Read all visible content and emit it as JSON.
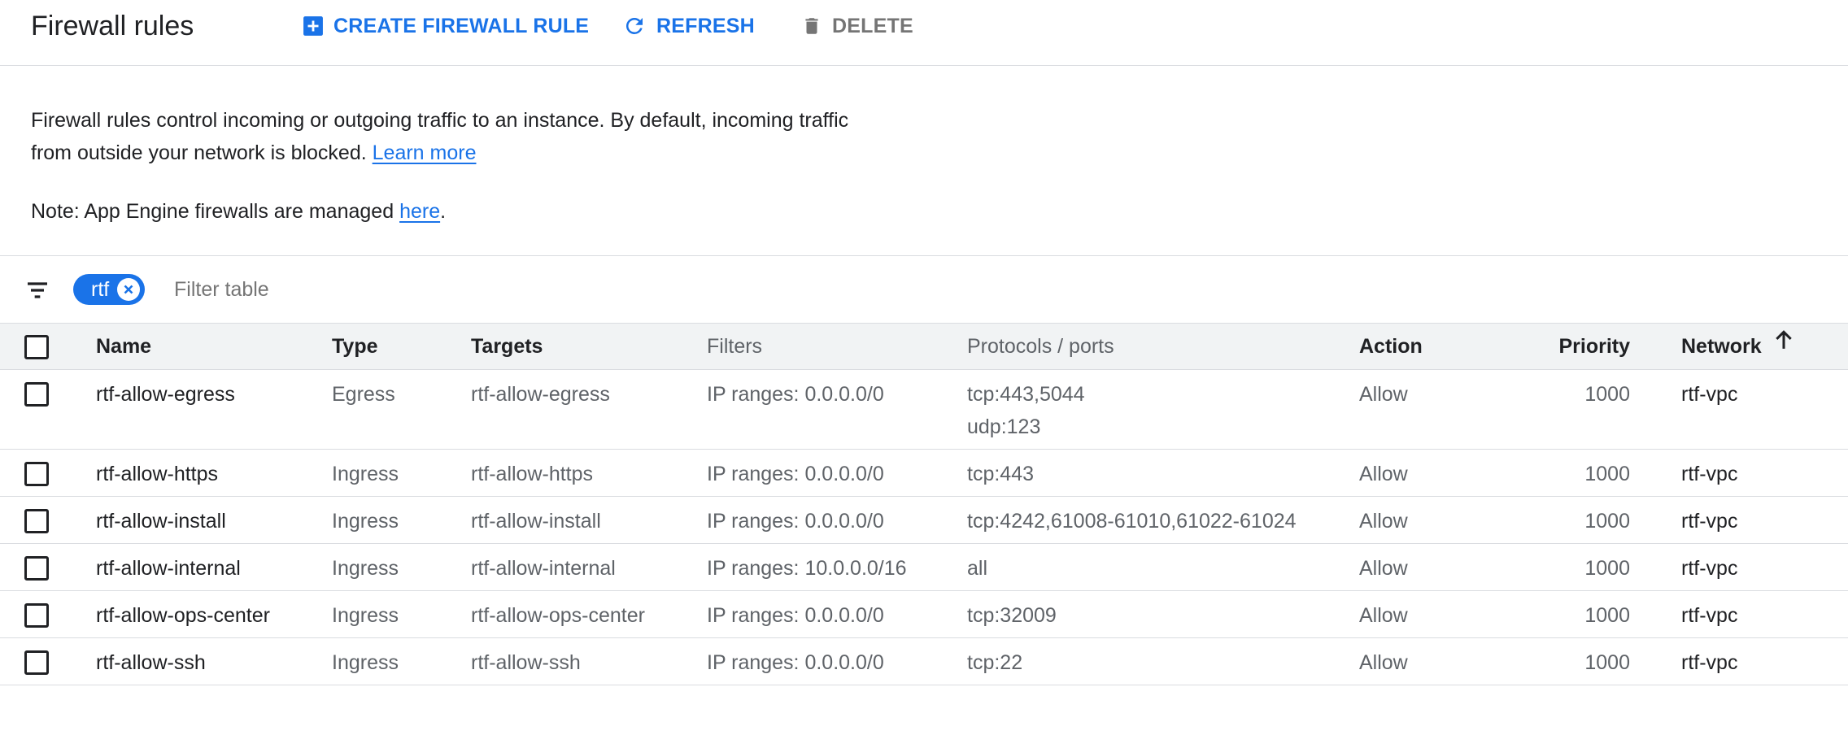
{
  "header": {
    "title": "Firewall rules",
    "create_label": "CREATE FIREWALL RULE",
    "refresh_label": "REFRESH",
    "delete_label": "DELETE"
  },
  "description": {
    "text": "Firewall rules control incoming or outgoing traffic to an instance. By default, incoming traffic from outside your network is blocked.",
    "learn_more": "Learn more",
    "note_prefix": "Note: App Engine firewalls are managed",
    "note_link": "here",
    "note_suffix": "."
  },
  "filter": {
    "chip_label": "rtf",
    "placeholder": "Filter table"
  },
  "table": {
    "columns": {
      "name": "Name",
      "type": "Type",
      "targets": "Targets",
      "filters": "Filters",
      "protocols": "Protocols / ports",
      "action": "Action",
      "priority": "Priority",
      "network": "Network"
    },
    "sort_column": "Network",
    "sort_direction": "ascending",
    "rows": [
      {
        "name": "rtf-allow-egress",
        "type": "Egress",
        "targets": "rtf-allow-egress",
        "filters": "IP ranges: 0.0.0.0/0",
        "protocols": [
          "tcp:443,5044",
          "udp:123"
        ],
        "action": "Allow",
        "priority": "1000",
        "network": "rtf-vpc"
      },
      {
        "name": "rtf-allow-https",
        "type": "Ingress",
        "targets": "rtf-allow-https",
        "filters": "IP ranges: 0.0.0.0/0",
        "protocols": [
          "tcp:443"
        ],
        "action": "Allow",
        "priority": "1000",
        "network": "rtf-vpc"
      },
      {
        "name": "rtf-allow-install",
        "type": "Ingress",
        "targets": "rtf-allow-install",
        "filters": "IP ranges: 0.0.0.0/0",
        "protocols": [
          "tcp:4242,61008-61010,61022-61024"
        ],
        "action": "Allow",
        "priority": "1000",
        "network": "rtf-vpc"
      },
      {
        "name": "rtf-allow-internal",
        "type": "Ingress",
        "targets": "rtf-allow-internal",
        "filters": "IP ranges: 10.0.0.0/16",
        "protocols": [
          "all"
        ],
        "action": "Allow",
        "priority": "1000",
        "network": "rtf-vpc"
      },
      {
        "name": "rtf-allow-ops-center",
        "type": "Ingress",
        "targets": "rtf-allow-ops-center",
        "filters": "IP ranges: 0.0.0.0/0",
        "protocols": [
          "tcp:32009"
        ],
        "action": "Allow",
        "priority": "1000",
        "network": "rtf-vpc"
      },
      {
        "name": "rtf-allow-ssh",
        "type": "Ingress",
        "targets": "rtf-allow-ssh",
        "filters": "IP ranges: 0.0.0.0/0",
        "protocols": [
          "tcp:22"
        ],
        "action": "Allow",
        "priority": "1000",
        "network": "rtf-vpc"
      }
    ]
  },
  "icons": {
    "create": "add-box-icon",
    "refresh": "refresh-icon",
    "delete": "trash-icon",
    "filter": "filter-list-icon",
    "chip_close": "close-circle-icon",
    "sort": "arrow-up-icon"
  },
  "colors": {
    "accent": "#1a73e8",
    "disabled": "#757575",
    "text_primary": "#202124",
    "text_secondary": "#5f6368",
    "divider": "#dadce0",
    "header_bg": "#f1f3f4"
  }
}
